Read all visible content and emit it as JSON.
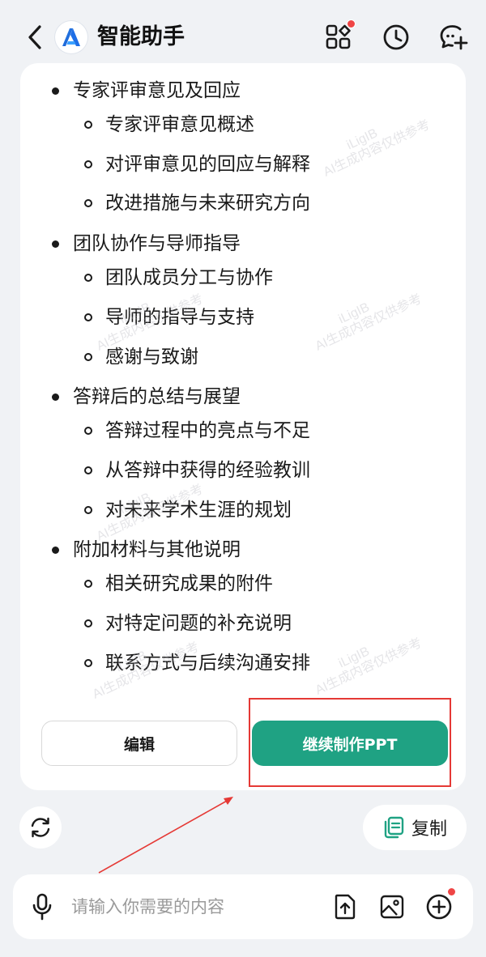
{
  "header": {
    "title": "智能助手",
    "back_icon": "chevron-left-icon",
    "logo_icon": "assistant-logo-icon",
    "apps_icon": "apps-grid-icon",
    "history_icon": "clock-icon",
    "new_chat_icon": "chat-plus-icon"
  },
  "outline": [
    {
      "level": 1,
      "text": "专家评审意见及回应"
    },
    {
      "level": 2,
      "text": "专家评审意见概述"
    },
    {
      "level": 2,
      "text": "对评审意见的回应与解释"
    },
    {
      "level": 2,
      "text": "改进措施与未来研究方向"
    },
    {
      "level": 1,
      "text": "团队协作与导师指导"
    },
    {
      "level": 2,
      "text": "团队成员分工与协作"
    },
    {
      "level": 2,
      "text": "导师的指导与支持"
    },
    {
      "level": 2,
      "text": "感谢与致谢"
    },
    {
      "level": 1,
      "text": "答辩后的总结与展望"
    },
    {
      "level": 2,
      "text": "答辩过程中的亮点与不足"
    },
    {
      "level": 2,
      "text": "从答辩中获得的经验教训"
    },
    {
      "level": 2,
      "text": "对未来学术生涯的规划"
    },
    {
      "level": 1,
      "text": "附加材料与其他说明"
    },
    {
      "level": 2,
      "text": "相关研究成果的附件"
    },
    {
      "level": 2,
      "text": "对特定问题的补充说明"
    },
    {
      "level": 2,
      "text": "联系方式与后续沟通安排"
    }
  ],
  "watermark": {
    "line1": "iLigIB",
    "line2": "AI生成内容仅供参考"
  },
  "actions": {
    "edit_label": "编辑",
    "continue_label": "继续制作PPT"
  },
  "toolbar": {
    "copy_label": "复制"
  },
  "input": {
    "placeholder": "请输入你需要的内容"
  },
  "colors": {
    "accent": "#1fa283",
    "badge": "#ef4545",
    "highlight": "#e53935"
  }
}
